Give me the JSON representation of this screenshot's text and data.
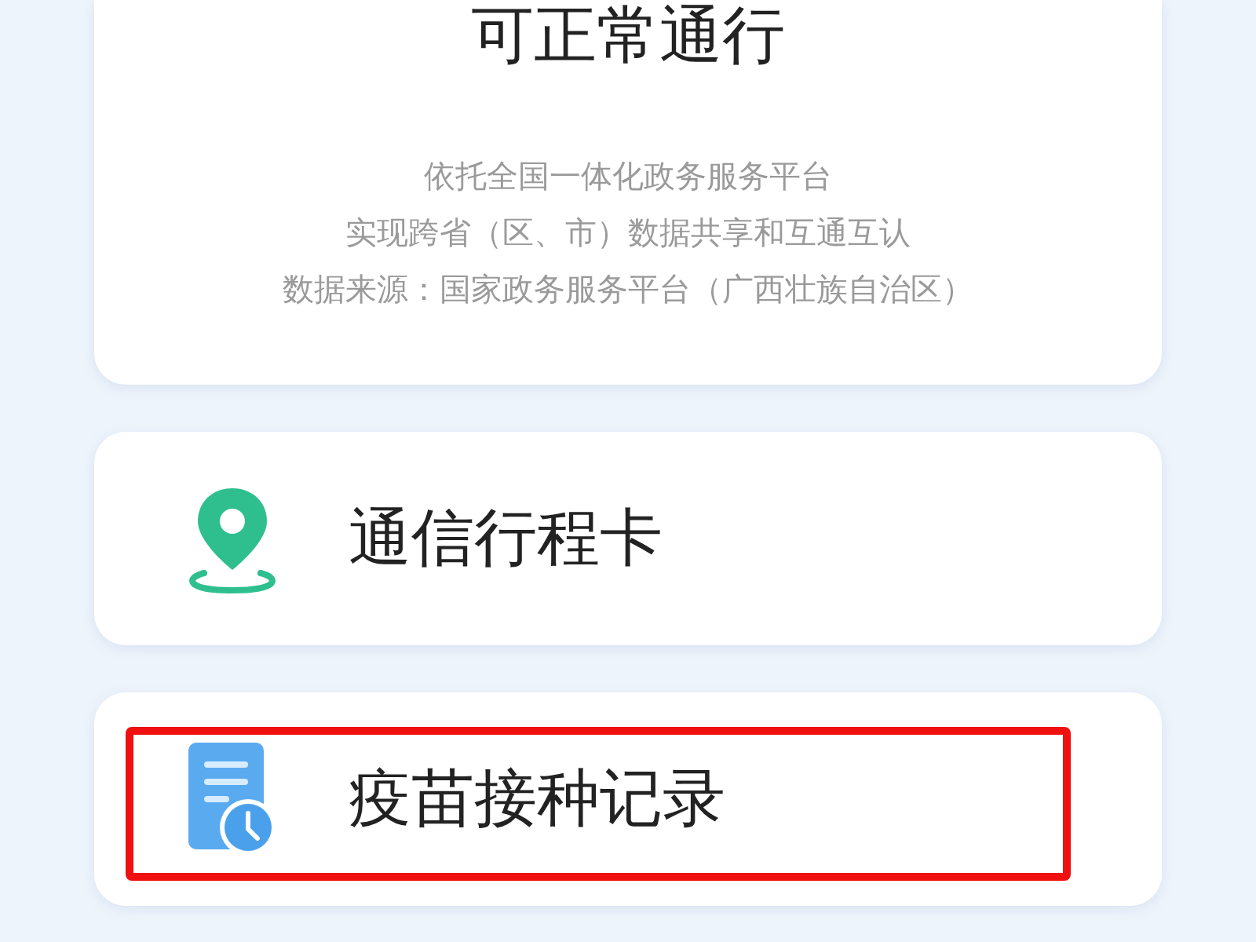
{
  "status_card": {
    "title": "可正常通行",
    "notes": [
      "依托全国一体化政务服务平台",
      "实现跨省（区、市）数据共享和互通互认",
      "数据来源：国家政务服务平台（广西壮族自治区）"
    ]
  },
  "entries": [
    {
      "kind": "location",
      "label": "通信行程卡",
      "highlighted": false
    },
    {
      "kind": "record",
      "label": "疫苗接种记录",
      "highlighted": true
    }
  ]
}
